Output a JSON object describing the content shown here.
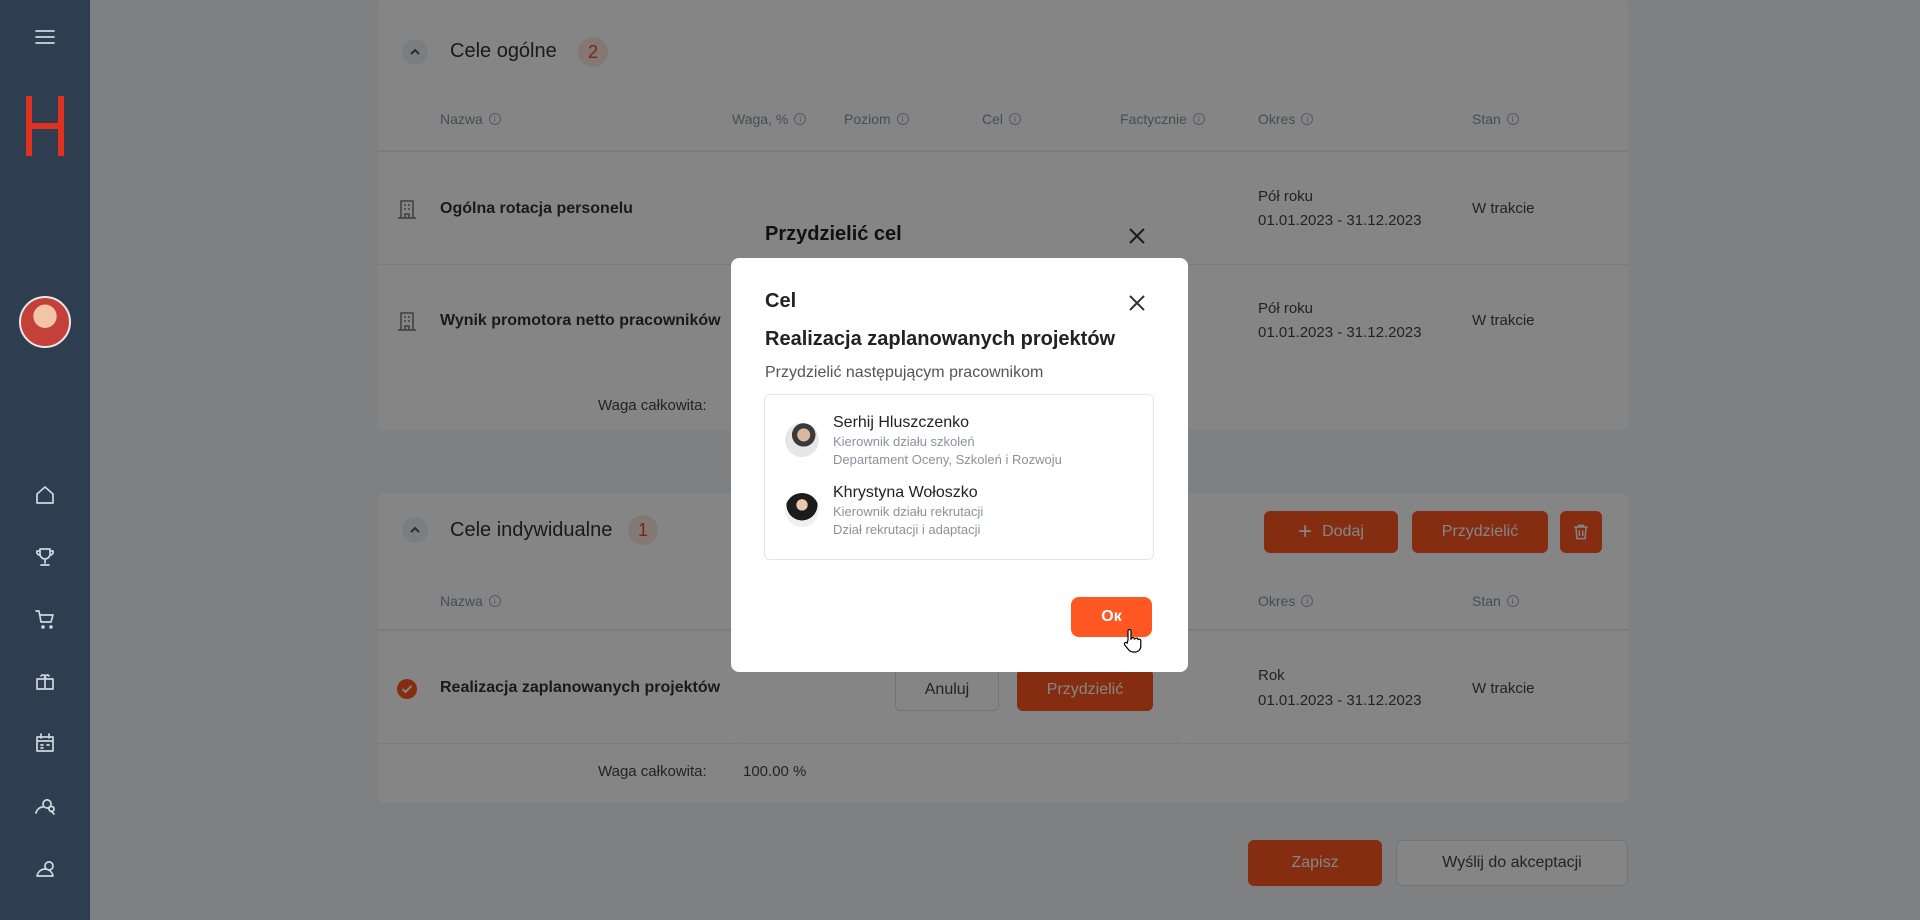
{
  "section1": {
    "title": "Cele ogólne",
    "count": "2",
    "columns": [
      "Nazwa",
      "Waga, %",
      "Poziom",
      "Cel",
      "Factycznie",
      "Okres",
      "Stan"
    ],
    "rows": [
      {
        "name": "Ogólna rotacja personelu",
        "period": "Pół roku",
        "dates": "01.01.2023 - 31.12.2023",
        "status": "W trakcie"
      },
      {
        "name": "Wynik promotora netto pracowników",
        "period": "Pół roku",
        "dates": "01.01.2023 - 31.12.2023",
        "status": "W trakcie"
      }
    ],
    "total_label": "Waga całkowita:"
  },
  "section2": {
    "title": "Cele indywidualne",
    "count": "1",
    "columns": [
      "Nazwa",
      "Okres",
      "Stan"
    ],
    "add_label": "Dodaj",
    "assign_label": "Przydzielić",
    "rows": [
      {
        "name": "Realizacja zaplanowanych projektów",
        "period": "Rok",
        "dates": "01.01.2023 - 31.12.2023",
        "status": "W trakcie"
      }
    ],
    "total_label": "Waga całkowita:",
    "total_value": "100.00 %"
  },
  "footer": {
    "save_label": "Zapisz",
    "send_label": "Wyślij do akceptacji"
  },
  "dialog_back": {
    "title": "Przydzielić cel",
    "cancel_label": "Anuluj",
    "assign_label": "Przydzielić"
  },
  "dialog": {
    "label": "Cel",
    "goal": "Realizacja zaplanowanych projektów",
    "subtitle": "Przydzielić następującym pracownikom",
    "people": [
      {
        "name": "Serhij Hluszczenko",
        "role": "Kierownik działu szkoleń",
        "dept": "Departament Oceny, Szkoleń i Rozwoju"
      },
      {
        "name": "Khrystyna Wołoszko",
        "role": "Kierownik działu rekrutacji",
        "dept": "Dział rekrutacji i adaptacji"
      }
    ],
    "ok_label": "Ок"
  },
  "colors": {
    "accent": "#ff5722",
    "sidebar": "#2e3d4f"
  }
}
